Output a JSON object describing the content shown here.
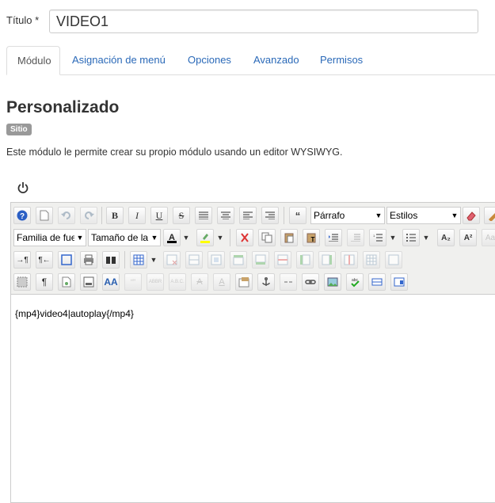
{
  "title_field": {
    "label": "Título *",
    "value": "VIDEO1"
  },
  "tabs": [
    {
      "label": "Módulo",
      "active": true
    },
    {
      "label": "Asignación de menú",
      "active": false
    },
    {
      "label": "Opciones",
      "active": false
    },
    {
      "label": "Avanzado",
      "active": false
    },
    {
      "label": "Permisos",
      "active": false
    }
  ],
  "module": {
    "title": "Personalizado",
    "badge": "Sitio",
    "description": "Este módulo le permite crear su propio módulo usando un editor WYSIWYG."
  },
  "editor": {
    "format_select": "Párrafo",
    "styles_select": "Estilos",
    "font_family_select": "Familia de fuente",
    "font_size_select": "Tamaño de la fuente",
    "content": "{mp4}video4|autoplay{/mp4}"
  },
  "colors": {
    "link": "#2a69b8",
    "badge": "#999999"
  }
}
